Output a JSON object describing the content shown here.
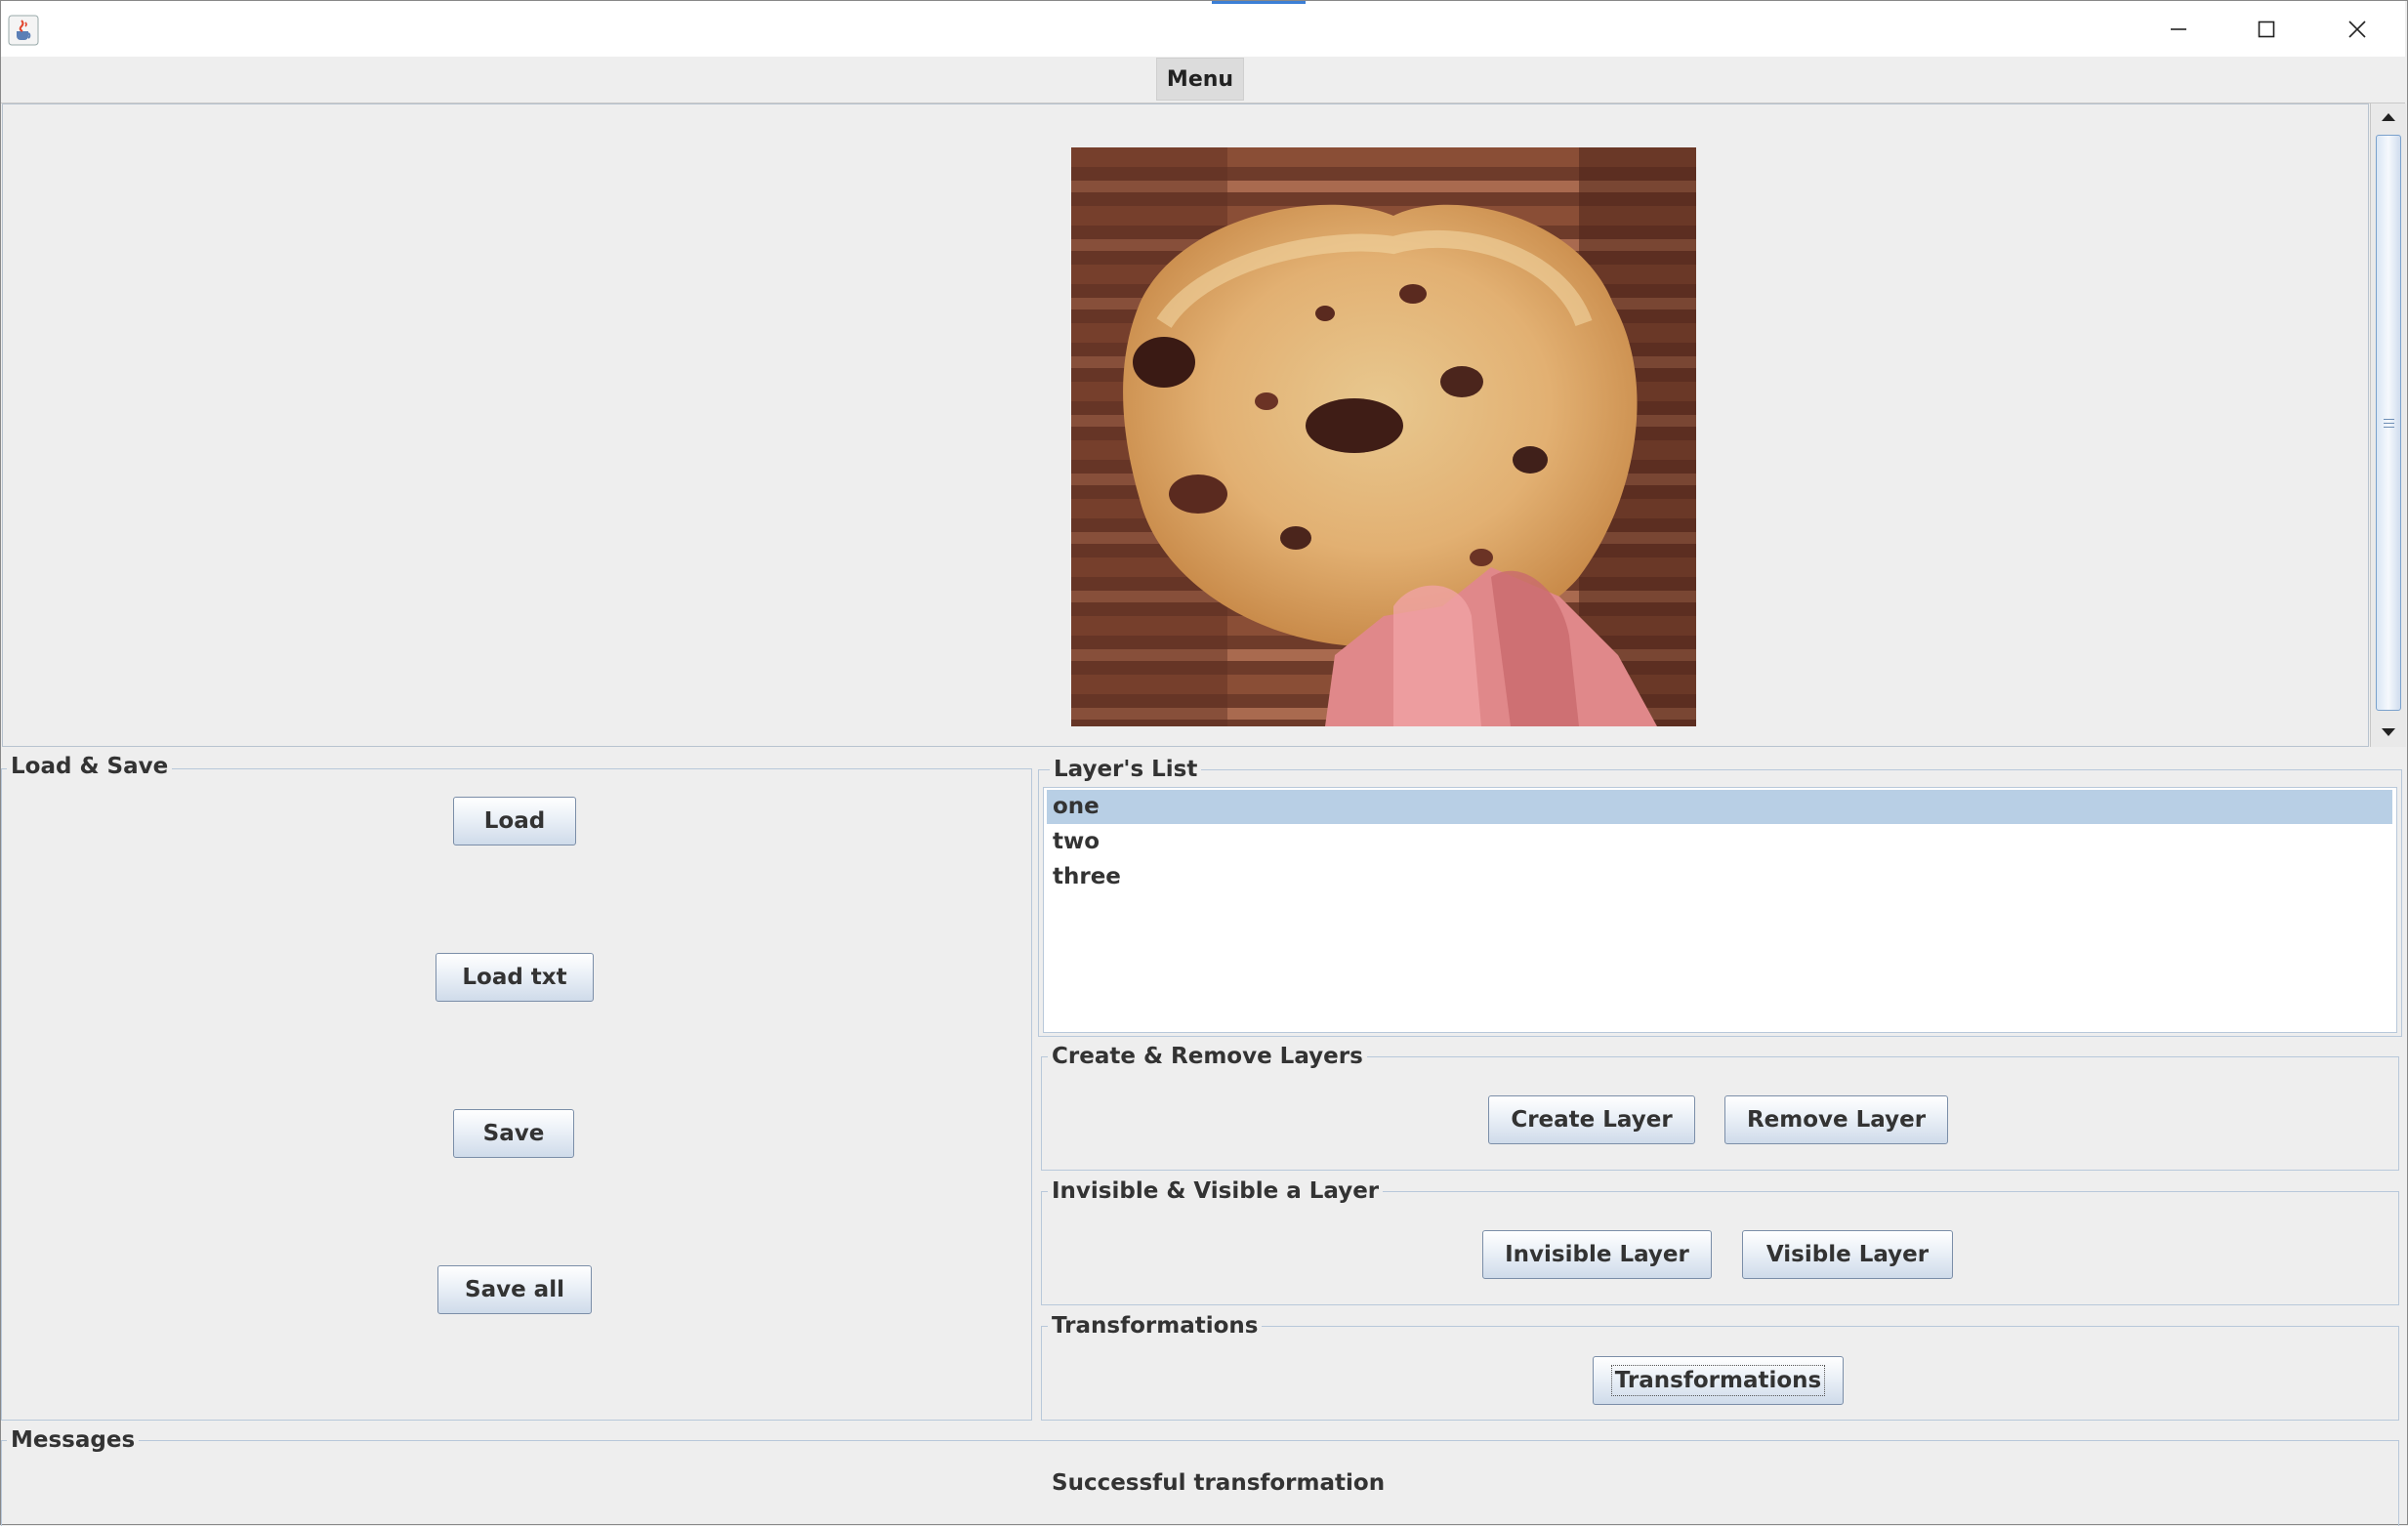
{
  "window": {
    "minimize_icon": "minimize-icon",
    "maximize_icon": "maximize-icon",
    "close_icon": "close-icon",
    "app_icon": "java-cup-icon"
  },
  "menu": {
    "label": "Menu"
  },
  "canvas": {
    "image_description_icon": "cookie-image"
  },
  "load_save": {
    "title": "Load & Save",
    "load": "Load",
    "load_txt": "Load txt",
    "save": "Save",
    "save_all": "Save all"
  },
  "layers_list": {
    "title": "Layer's List",
    "items": [
      "one",
      "two",
      "three"
    ],
    "selected_index": 0
  },
  "create_remove": {
    "title": "Create & Remove Layers",
    "create": "Create Layer",
    "remove": "Remove Layer"
  },
  "visibility": {
    "title": "Invisible & Visible a Layer",
    "invisible": "Invisible Layer",
    "visible": "Visible Layer"
  },
  "transformations": {
    "title": "Transformations",
    "button": "Transformations"
  },
  "messages": {
    "title": "Messages",
    "text": "Successful transformation"
  },
  "colors": {
    "selection": "#b8cfe5",
    "accent": "#3c7fd6",
    "panel_bg": "#eeeeee"
  }
}
